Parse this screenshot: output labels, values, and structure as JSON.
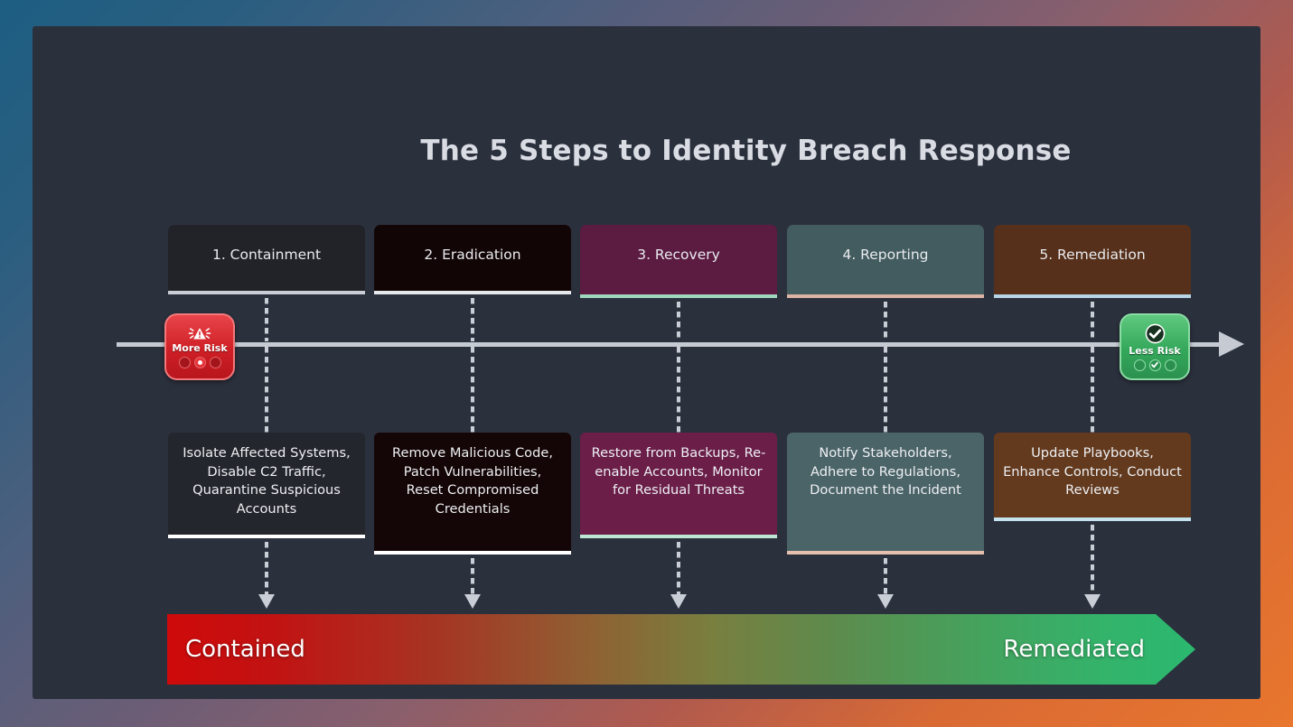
{
  "title": "The 5 Steps to Identity Breach Response",
  "background": {
    "from": "#1d5e82",
    "to": "#e8762e"
  },
  "card_bg": "#2b303d",
  "timeline": {
    "arrow_color": "#c6cad2",
    "start_badge": {
      "label": "More Risk",
      "color": "#cf1f26",
      "icon": "warning-triangle-icon"
    },
    "end_badge": {
      "label": "Less Risk",
      "color": "#34a85a",
      "icon": "check-circle-icon"
    }
  },
  "steps": [
    {
      "header": "1. Containment",
      "header_bg": "#212329",
      "accent": "#c9cdd5",
      "desc": "Isolate Affected Systems, Disable C2 Traffic, Quarantine Suspicious Accounts",
      "desc_bg": "#23262c",
      "desc_accent": "#ffffff"
    },
    {
      "header": "2. Eradication",
      "header_bg": "#120506",
      "accent": "#e6e8ec",
      "desc": "Remove Malicious Code, Patch Vulnerabilities, Reset Compromised Credentials",
      "desc_bg": "#140506",
      "desc_accent": "#ffffff"
    },
    {
      "header": "3. Recovery",
      "header_bg": "#5c1b41",
      "accent": "#9fd9bd",
      "desc": "Restore from Backups, Re-enable Accounts, Monitor for Residual Threats",
      "desc_bg": "#6a1e48",
      "desc_accent": "#bde6d4"
    },
    {
      "header": "4. Reporting",
      "header_bg": "#435c60",
      "accent": "#ddb3a5",
      "desc": "Notify Stakeholders, Adhere to Regulations, Document the Incident",
      "desc_bg": "#4b6468",
      "desc_accent": "#e6bfae"
    },
    {
      "header": "5. Remediation",
      "header_bg": "#56301a",
      "accent": "#b6d4e6",
      "desc": "Update Playbooks, Enhance Controls, Conduct Reviews",
      "desc_bg": "#633a1e",
      "desc_accent": "#c4e3ef"
    }
  ],
  "progress_bar": {
    "start_label": "Contained",
    "end_label": "Remediated",
    "from_color": "#cf0a0a",
    "to_color": "#2bb86f"
  },
  "chart_data": {
    "type": "diagram",
    "title": "The 5 Steps to Identity Breach Response",
    "flow": "left-to-right risk reduction timeline",
    "stages": [
      "1. Containment",
      "2. Eradication",
      "3. Recovery",
      "4. Reporting",
      "5. Remediation"
    ],
    "axis_start": "More Risk",
    "axis_end": "Less Risk",
    "outcome_start": "Contained",
    "outcome_end": "Remediated"
  }
}
